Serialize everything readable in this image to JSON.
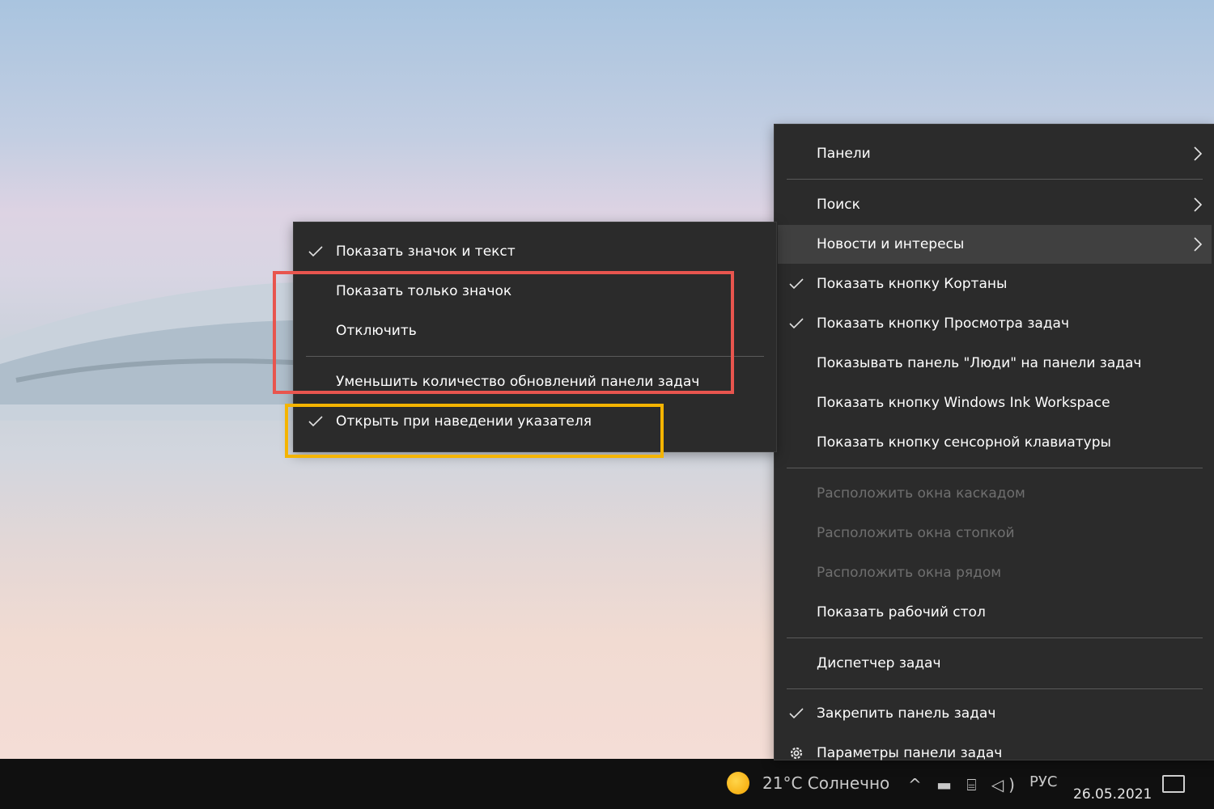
{
  "main_menu": {
    "items": [
      {
        "label": "Панели",
        "submenu": true
      },
      {
        "label": "Поиск",
        "submenu": true
      },
      {
        "label": "Новости и интересы",
        "submenu": true,
        "hovered": true
      },
      {
        "label": "Показать кнопку Кортаны",
        "checked": true
      },
      {
        "label": "Показать кнопку Просмотра задач",
        "checked": true
      },
      {
        "label": "Показывать панель \"Люди\" на панели задач"
      },
      {
        "label": "Показать кнопку Windows Ink Workspace"
      },
      {
        "label": "Показать кнопку сенсорной клавиатуры"
      },
      {
        "label": "Расположить окна каскадом",
        "disabled": true
      },
      {
        "label": "Расположить окна стопкой",
        "disabled": true
      },
      {
        "label": "Расположить окна рядом",
        "disabled": true
      },
      {
        "label": "Показать рабочий стол"
      },
      {
        "label": "Диспетчер задач"
      },
      {
        "label": "Закрепить панель задач",
        "checked": true
      },
      {
        "label": "Параметры панели задач",
        "icon": "gear-icon"
      }
    ]
  },
  "sub_menu": {
    "items": [
      {
        "label": "Показать значок и текст",
        "checked": true
      },
      {
        "label": "Показать только значок"
      },
      {
        "label": "Отключить"
      },
      {
        "label": "Уменьшить количество обновлений панели задач"
      },
      {
        "label": "Открыть при наведении указателя",
        "checked": true
      }
    ]
  },
  "taskbar": {
    "weather": "21°C  Солнечно",
    "tray": "^ ▬ ⌸ ◁)",
    "lang": "РУС",
    "date": "26.05.2021"
  },
  "colors": {
    "menu_bg": "#2b2b2b",
    "hover_bg": "#404040",
    "highlight_red": "#e8554e",
    "highlight_yellow": "#f4b400"
  }
}
